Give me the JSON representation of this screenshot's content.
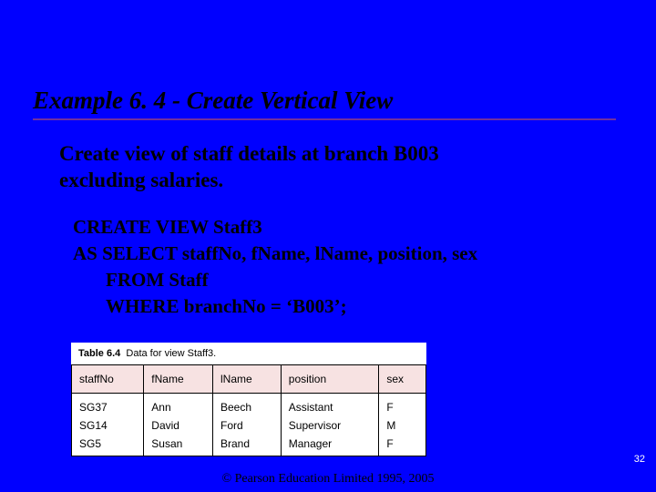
{
  "title": "Example 6. 4 - Create Vertical View",
  "subtitle_line1": "Create view of staff details at branch B003",
  "subtitle_line2": "excluding salaries.",
  "sql": {
    "line1": "CREATE VIEW Staff3",
    "line2": "AS SELECT staffNo, fName, lName, position, sex",
    "line3": "FROM Staff",
    "line4": "WHERE branchNo = ‘B003’;"
  },
  "table": {
    "caption_label": "Table 6.4",
    "caption_text": "Data for view Staff3.",
    "headers": [
      "staffNo",
      "fName",
      "lName",
      "position",
      "sex"
    ],
    "rows": [
      [
        "SG37",
        "Ann",
        "Beech",
        "Assistant",
        "F"
      ],
      [
        "SG14",
        "David",
        "Ford",
        "Supervisor",
        "M"
      ],
      [
        "SG5",
        "Susan",
        "Brand",
        "Manager",
        "F"
      ]
    ]
  },
  "page_number": "32",
  "copyright": "© Pearson Education Limited 1995, 2005"
}
